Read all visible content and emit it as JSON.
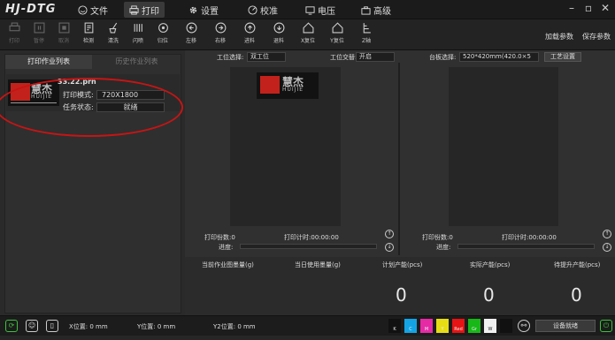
{
  "app": {
    "brand": "HJ-DTG"
  },
  "menu": {
    "tabs": [
      {
        "label": "文件",
        "icon": "smiley-icon"
      },
      {
        "label": "打印",
        "icon": "printer-icon"
      },
      {
        "label": "设置",
        "icon": "gear-icon"
      },
      {
        "label": "校准",
        "icon": "calibrate-icon"
      },
      {
        "label": "电压",
        "icon": "monitor-icon"
      },
      {
        "label": "高级",
        "icon": "briefcase-icon"
      }
    ]
  },
  "toolbar": {
    "tools": [
      {
        "label": "打印",
        "icon": "print-icon",
        "enabled": false
      },
      {
        "label": "暂停",
        "icon": "pause-icon",
        "enabled": false
      },
      {
        "label": "取消",
        "icon": "stop-icon",
        "enabled": false
      },
      {
        "label": "检测",
        "icon": "check-icon",
        "enabled": true
      },
      {
        "label": "清洗",
        "icon": "clean-icon",
        "enabled": true
      },
      {
        "label": "闪喷",
        "icon": "flash-spray-icon",
        "enabled": true
      },
      {
        "label": "归位",
        "icon": "home-target-icon",
        "enabled": true
      },
      {
        "label": "左移",
        "icon": "arrow-left-icon",
        "enabled": true
      },
      {
        "label": "右移",
        "icon": "arrow-right-icon",
        "enabled": true
      },
      {
        "label": "进料",
        "icon": "arrow-up-icon",
        "enabled": true
      },
      {
        "label": "退料",
        "icon": "arrow-down-icon",
        "enabled": true
      },
      {
        "label": "X复位",
        "icon": "x-home-icon",
        "enabled": true
      },
      {
        "label": "Y复位",
        "icon": "y-home-icon",
        "enabled": true
      },
      {
        "label": "Z轴",
        "icon": "z-axis-icon",
        "enabled": true
      }
    ],
    "load_params": "加载参数",
    "save_params": "保存参数"
  },
  "left_panel": {
    "tab_active": "打印作业列表",
    "tab_inactive": "历史作业列表",
    "job": {
      "filename": "33.22.prn",
      "mode_label": "打印模式:",
      "mode_value": "720X1800",
      "status_label": "任务状态:",
      "status_value": "就绪",
      "logo_cn": "慧杰",
      "logo_en": "HUIJIE"
    }
  },
  "main": {
    "station_label": "工位选择:",
    "station_value": "双工位",
    "alternate_label": "工位交替:",
    "alternate_value": "开启",
    "platen_label": "台板选择:",
    "platen_value": "520*420mm(420.0×5",
    "process_button": "工艺设置",
    "left_station": {
      "count_label": "打印份数:",
      "count": "0",
      "timer_label": "打印计时:",
      "timer": "00:00:00",
      "progress_label": "进度:"
    },
    "right_station": {
      "count_label": "打印份数:",
      "count": "0",
      "timer_label": "打印计时:",
      "timer": "00:00:00",
      "progress_label": "进度:"
    },
    "ink_current_label": "当前作业图墨量(g)",
    "ink_today_label": "当日使用墨量(g)",
    "stats": [
      {
        "label": "计划产能(pcs)",
        "value": "0"
      },
      {
        "label": "实际产能(pcs)",
        "value": "0"
      },
      {
        "label": "待提升产能(pcs)",
        "value": "0"
      }
    ]
  },
  "status": {
    "x_pos": "X位置: 0 mm",
    "y_pos": "Y位置: 0 mm",
    "y2_pos": "Y2位置: 0 mm",
    "device_button": "设备就绪",
    "inks": [
      {
        "label": "K",
        "color": "#111111"
      },
      {
        "label": "C",
        "color": "#14a4e6"
      },
      {
        "label": "M",
        "color": "#e62aa6"
      },
      {
        "label": "Y",
        "color": "#e6dd14"
      },
      {
        "label": "Red",
        "color": "#e61414"
      },
      {
        "label": "Gr",
        "color": "#18b818"
      },
      {
        "label": "W",
        "color": "#f2f2f2"
      },
      {
        "label": "",
        "color": "#111111"
      }
    ]
  },
  "colors": {
    "accent_red": "#c81414",
    "logo_red": "#c2221b",
    "background": "#2a2a2a"
  }
}
